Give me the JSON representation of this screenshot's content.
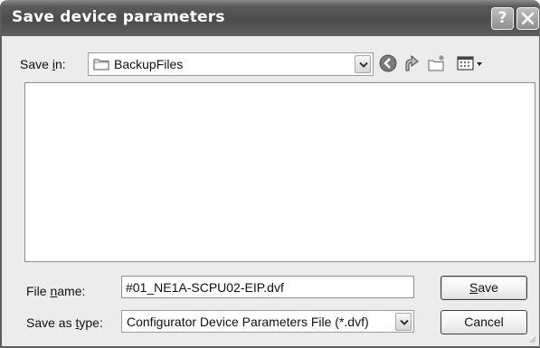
{
  "window": {
    "title": "Save device parameters",
    "help_label": "?",
    "close_label": "✕"
  },
  "toolbar": {
    "save_in_label": "Save in:",
    "save_in_value": "BackupFiles",
    "icons": [
      "back-icon",
      "up-folder-icon",
      "new-folder-icon",
      "views-menu-icon"
    ]
  },
  "file_list": {
    "items": []
  },
  "form": {
    "file_name_label": "File name:",
    "file_name_value": "#01_NE1A-SCPU02-EIP.dvf",
    "save_as_type_label": "Save as type:",
    "save_as_type_value": "Configurator Device Parameters File (*.dvf)"
  },
  "buttons": {
    "save": "Save",
    "cancel": "Cancel"
  }
}
